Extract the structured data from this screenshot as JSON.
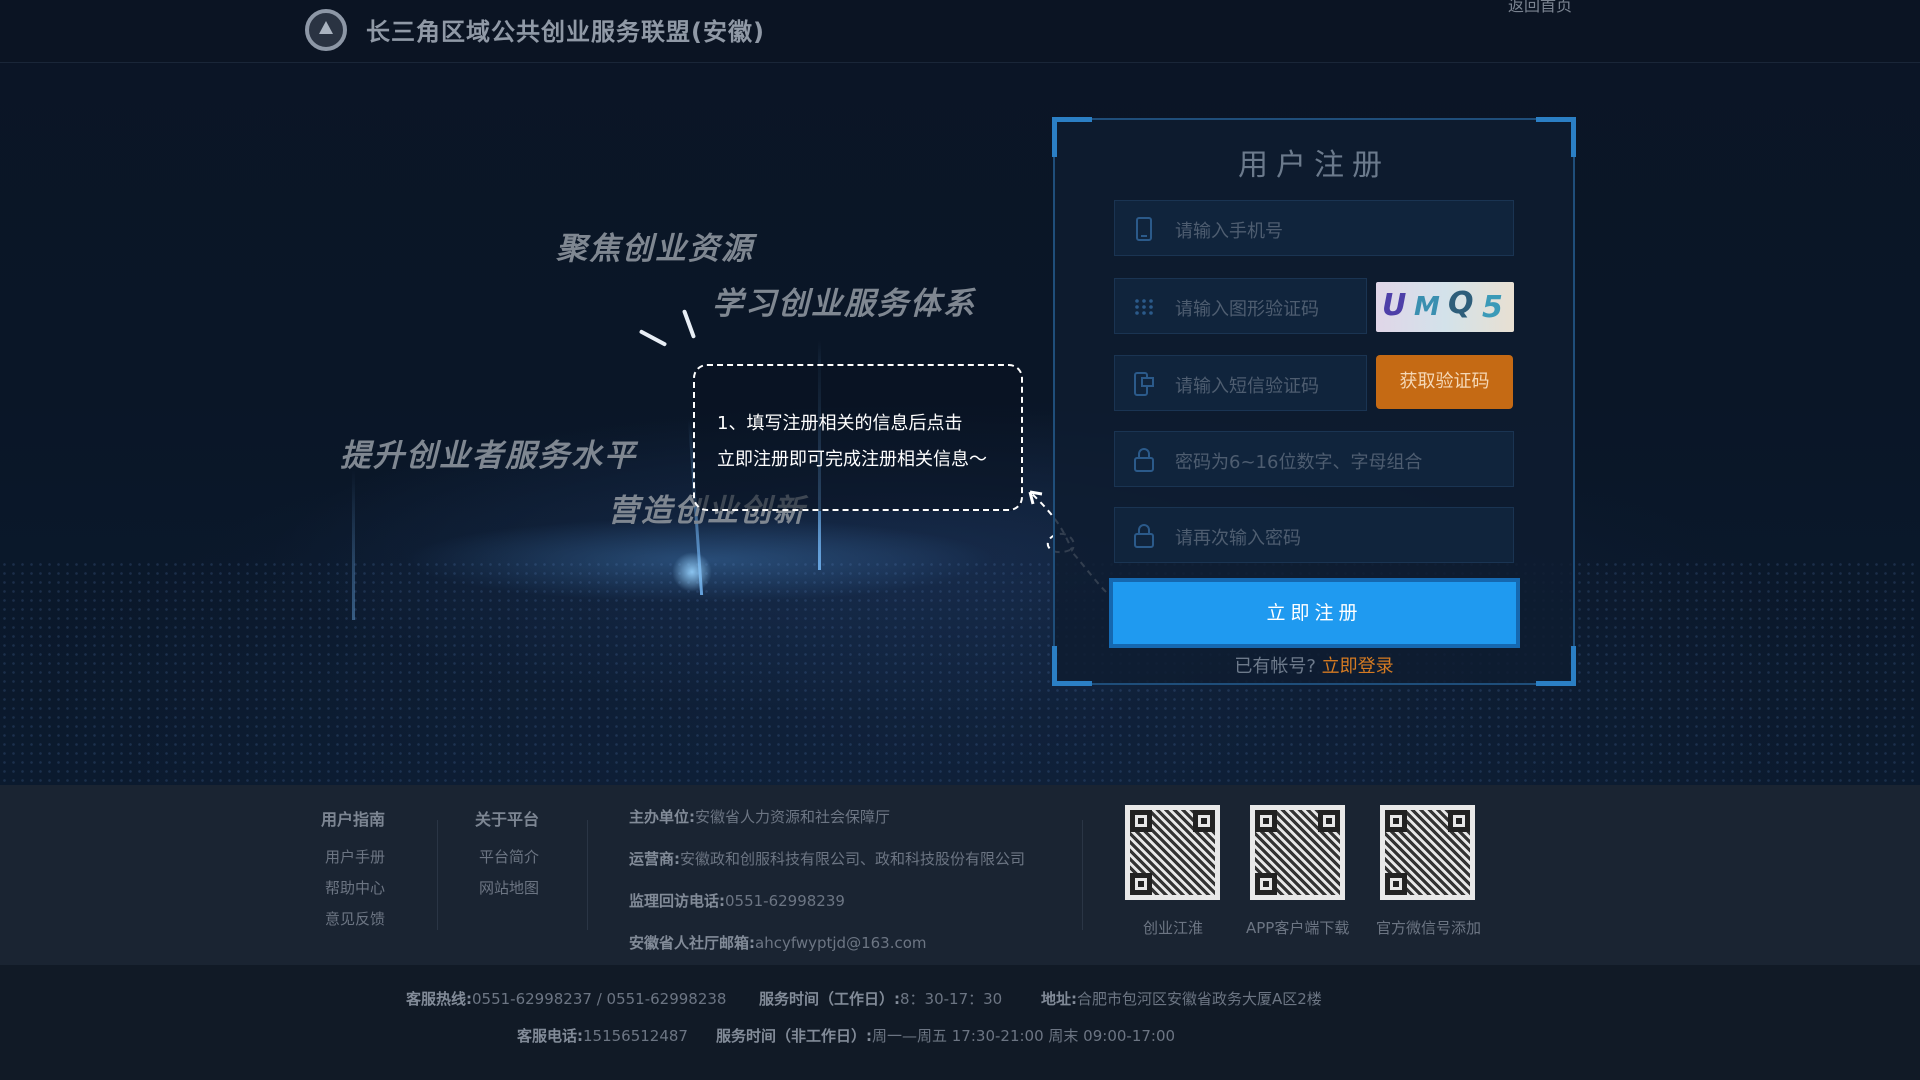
{
  "header": {
    "title": "长三角区域公共创业服务联盟(安徽)",
    "home_link": "返回首页"
  },
  "slogans": {
    "line1": "聚焦创业资源",
    "line2": "学习创业服务体系",
    "line3": "提升创业者服务水平",
    "line4": "营造创业创新"
  },
  "tip": {
    "line1": "1、填写注册相关的信息后点击",
    "line2": "立即注册即可完成注册相关信息～"
  },
  "register": {
    "title": "用户注册",
    "phone_placeholder": "请输入手机号",
    "captcha_placeholder": "请输入图形验证码",
    "captcha_text": [
      "U",
      "M",
      "Q",
      "5"
    ],
    "sms_placeholder": "请输入短信验证码",
    "sms_button": "获取验证码",
    "password_placeholder": "密码为6~16位数字、字母组合",
    "confirm_placeholder": "请再次输入密码",
    "submit": "立即注册",
    "have_account": "已有帐号?",
    "login_link": "立即登录"
  },
  "footer": {
    "guide": {
      "title": "用户指南",
      "items": [
        "用户手册",
        "帮助中心",
        "意见反馈"
      ]
    },
    "about": {
      "title": "关于平台",
      "items": [
        "平台简介",
        "网站地图"
      ]
    },
    "info": [
      {
        "label": "主办单位:",
        "value": "安徽省人力资源和社会保障厅"
      },
      {
        "label": "运营商:",
        "value": "安徽政和创服科技有限公司、政和科技股份有限公司"
      },
      {
        "label": "监理回访电话:",
        "value": "0551-62998239"
      },
      {
        "label": "安徽省人社厅邮箱:",
        "value": "ahcyfwyptjd@163.com"
      }
    ],
    "qrcodes": [
      {
        "caption": "创业江淮"
      },
      {
        "caption": "APP客户端下载"
      },
      {
        "caption": "官方微信号添加"
      }
    ],
    "bottom": {
      "hotline_label": "客服热线:",
      "hotline": "0551-62998237 / 0551-62998238",
      "service_time_label": "服务时间（工作日）:",
      "service_time": "8：30-17：30",
      "address_label": "地址:",
      "address": "合肥市包河区安徽省政务大厦A区2楼",
      "phone_label": "客服电话:",
      "phone": "15156512487",
      "service_time2_label": "服务时间（非工作日）:",
      "service_time2": "周一—周五 17:30-21:00 周末 09:00-17:00"
    }
  },
  "colors": {
    "accent_blue": "#1f9af0",
    "accent_orange": "#c56a14",
    "link_orange": "#d47a22"
  }
}
